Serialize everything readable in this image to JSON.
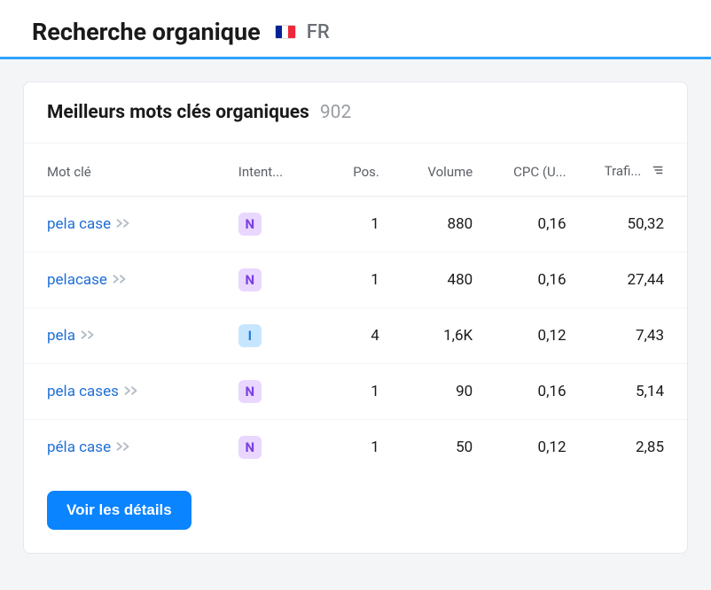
{
  "header": {
    "title": "Recherche organique",
    "country_code": "FR"
  },
  "card": {
    "title": "Meilleurs mots clés organiques",
    "count": "902",
    "columns": {
      "keyword": "Mot clé",
      "intent": "Intent...",
      "position": "Pos.",
      "volume": "Volume",
      "cpc": "CPC (U...",
      "traffic": "Trafi..."
    },
    "rows": [
      {
        "keyword": "pela case",
        "intent": "N",
        "position": "1",
        "volume": "880",
        "cpc": "0,16",
        "traffic": "50,32"
      },
      {
        "keyword": "pelacase",
        "intent": "N",
        "position": "1",
        "volume": "480",
        "cpc": "0,16",
        "traffic": "27,44"
      },
      {
        "keyword": "pela",
        "intent": "I",
        "position": "4",
        "volume": "1,6K",
        "cpc": "0,12",
        "traffic": "7,43"
      },
      {
        "keyword": "pela cases",
        "intent": "N",
        "position": "1",
        "volume": "90",
        "cpc": "0,16",
        "traffic": "5,14"
      },
      {
        "keyword": "péla case",
        "intent": "N",
        "position": "1",
        "volume": "50",
        "cpc": "0,12",
        "traffic": "2,85"
      }
    ],
    "button_label": "Voir les détails"
  }
}
